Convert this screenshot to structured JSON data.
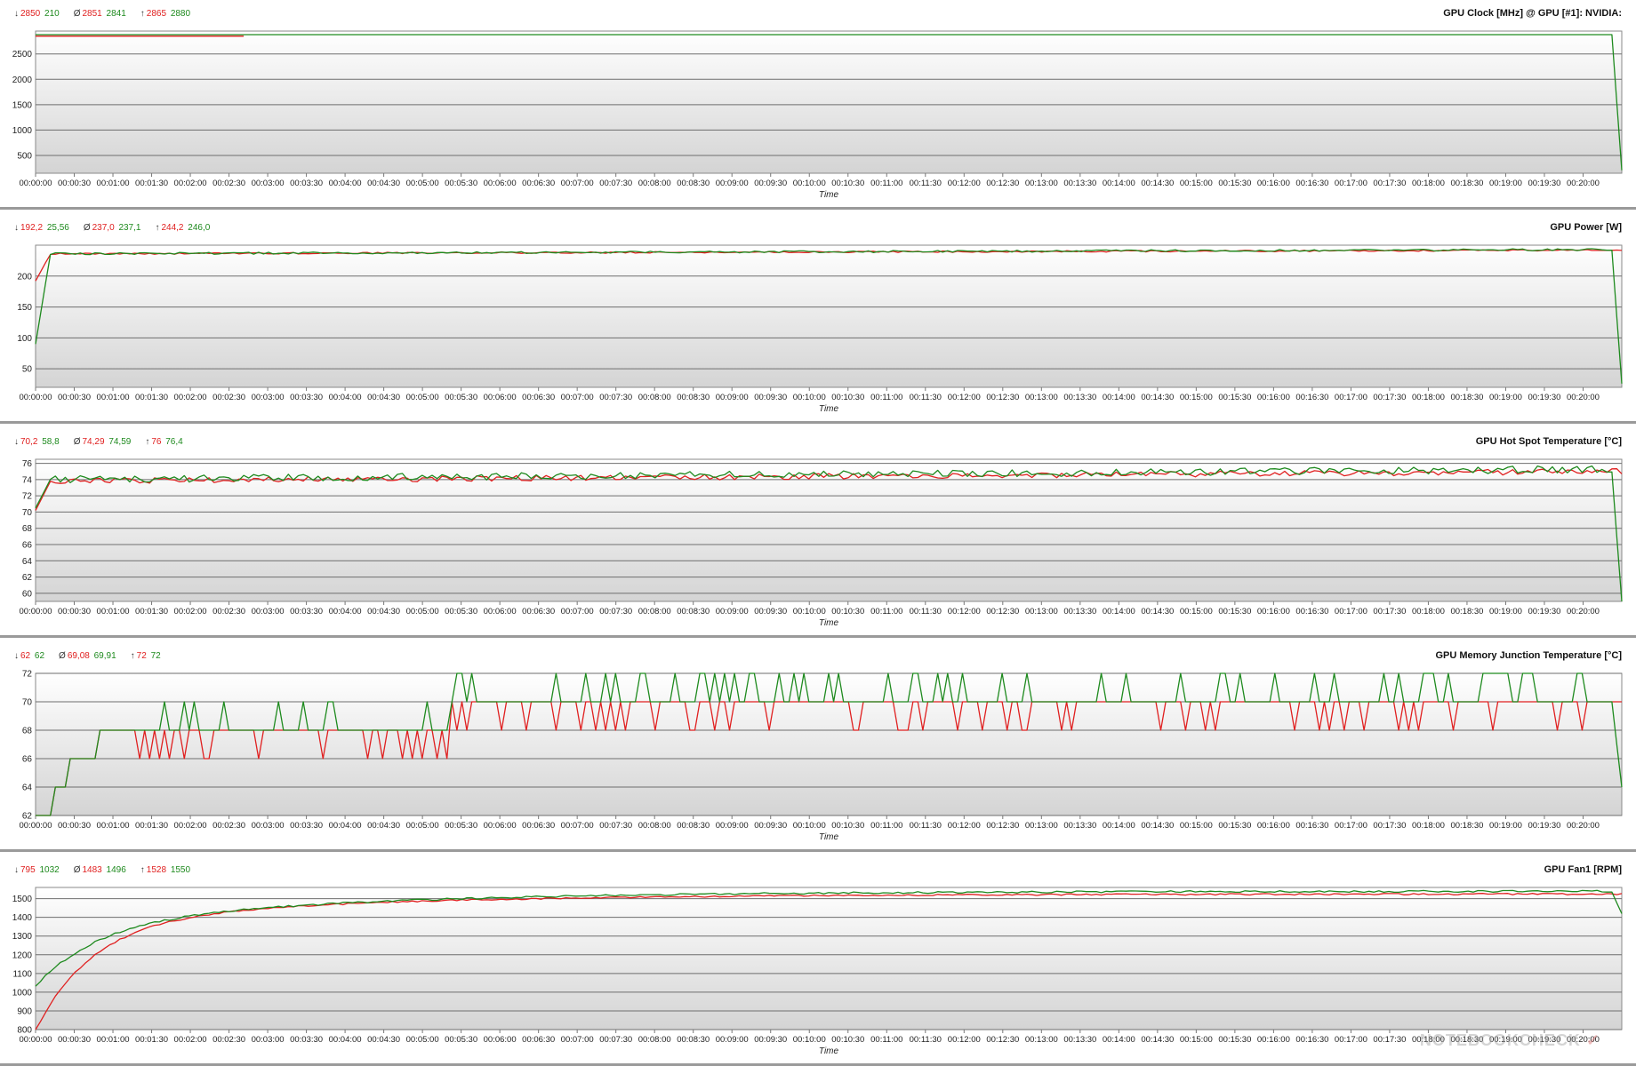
{
  "chart_data": [
    {
      "type": "line",
      "title": "GPU Clock [MHz] @ GPU [#1]: NVIDIA:",
      "xlabel": "Time",
      "stats": {
        "min": [
          "2850",
          "210"
        ],
        "avg": [
          "2851",
          "2841"
        ],
        "max": [
          "2865",
          "2880"
        ]
      },
      "ylim": [
        150,
        2950
      ],
      "yticks": [
        500,
        1000,
        1500,
        2000,
        2500
      ],
      "duration_s": 1230,
      "series": [
        {
          "color": "#e02020",
          "pattern": "flat",
          "base": 2851,
          "noise": 0,
          "end_drop": null,
          "partial_end_s": 160
        },
        {
          "color": "#1e8a1e",
          "pattern": "flat",
          "base": 2880,
          "noise": 0,
          "end_drop": 210
        }
      ]
    },
    {
      "type": "line",
      "title": "GPU Power [W]",
      "xlabel": "Time",
      "stats": {
        "min": [
          "192,2",
          "25,56"
        ],
        "avg": [
          "237,0",
          "237,1"
        ],
        "max": [
          "244,2",
          "246,0"
        ]
      },
      "ylim": [
        20,
        250
      ],
      "yticks": [
        50,
        100,
        150,
        200
      ],
      "duration_s": 1230,
      "series": [
        {
          "color": "#e02020",
          "pattern": "rise",
          "start": 192,
          "base_start": 236,
          "base_end": 242,
          "noise": 1.2,
          "end_drop": null
        },
        {
          "color": "#1e8a1e",
          "pattern": "rise",
          "start": 90,
          "base_start": 236,
          "base_end": 243,
          "noise": 1.6,
          "end_drop": 26
        }
      ]
    },
    {
      "type": "line",
      "title": "GPU Hot Spot Temperature [°C]",
      "xlabel": "Time",
      "stats": {
        "min": [
          "70,2",
          "58,8"
        ],
        "avg": [
          "74,29",
          "74,59"
        ],
        "max": [
          "76",
          "76,4"
        ]
      },
      "ylim": [
        59,
        76.5
      ],
      "yticks": [
        60,
        62,
        64,
        66,
        68,
        70,
        72,
        74,
        76
      ],
      "duration_s": 1230,
      "series": [
        {
          "color": "#e02020",
          "pattern": "rise",
          "start": 70.2,
          "base_start": 73.8,
          "base_end": 75.0,
          "noise": 0.35,
          "end_drop": null
        },
        {
          "color": "#1e8a1e",
          "pattern": "rise",
          "start": 70.5,
          "base_start": 74.0,
          "base_end": 75.3,
          "noise": 0.45,
          "end_drop": 59
        }
      ]
    },
    {
      "type": "line",
      "title": "GPU Memory Junction Temperature [°C]",
      "xlabel": "Time",
      "stats": {
        "min": [
          "62",
          "62"
        ],
        "avg": [
          "69,08",
          "69,91"
        ],
        "max": [
          "72",
          "72"
        ]
      },
      "ylim": [
        62,
        72
      ],
      "yticks": [
        62,
        64,
        66,
        68,
        70,
        72
      ],
      "duration_s": 1230,
      "series": [
        {
          "color": "#e02020",
          "pattern": "step",
          "spikes": "down",
          "end_drop": null
        },
        {
          "color": "#1e8a1e",
          "pattern": "step",
          "spikes": "up",
          "end_drop": 64
        }
      ]
    },
    {
      "type": "line",
      "title": "GPU Fan1 [RPM]",
      "xlabel": "Time",
      "stats": {
        "min": [
          "795",
          "1032"
        ],
        "avg": [
          "1483",
          "1496"
        ],
        "max": [
          "1528",
          "1550"
        ]
      },
      "ylim": [
        800,
        1560
      ],
      "yticks": [
        800,
        900,
        1000,
        1100,
        1200,
        1300,
        1400,
        1500
      ],
      "duration_s": 1230,
      "series": [
        {
          "color": "#e02020",
          "pattern": "fan",
          "start": 795,
          "base_start": 1360,
          "base_end": 1525,
          "noise": 4,
          "end_drop": null
        },
        {
          "color": "#1e8a1e",
          "pattern": "fan",
          "start": 1032,
          "base_start": 1340,
          "base_end": 1540,
          "noise": 5,
          "end_drop": 1420
        }
      ]
    }
  ],
  "xticks": [
    "00:00:00",
    "00:00:30",
    "00:01:00",
    "00:01:30",
    "00:02:00",
    "00:02:30",
    "00:03:00",
    "00:03:30",
    "00:04:00",
    "00:04:30",
    "00:05:00",
    "00:05:30",
    "00:06:00",
    "00:06:30",
    "00:07:00",
    "00:07:30",
    "00:08:00",
    "00:08:30",
    "00:09:00",
    "00:09:30",
    "00:10:00",
    "00:10:30",
    "00:11:00",
    "00:11:30",
    "00:12:00",
    "00:12:30",
    "00:13:00",
    "00:13:30",
    "00:14:00",
    "00:14:30",
    "00:15:00",
    "00:15:30",
    "00:16:00",
    "00:16:30",
    "00:17:00",
    "00:17:30",
    "00:18:00",
    "00:18:30",
    "00:19:00",
    "00:19:30",
    "00:20:00"
  ],
  "colors": {
    "current": "#e02020",
    "max": "#1e8a1e",
    "grid": "#6e6e6e"
  },
  "watermark": "NOTEBOOKCHECK"
}
